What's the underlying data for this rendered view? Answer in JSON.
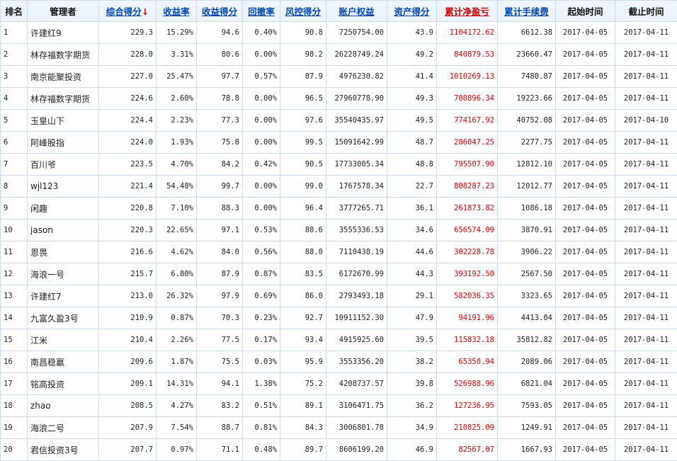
{
  "columns": [
    {
      "label": "排名",
      "style": "plain"
    },
    {
      "label": "管理者",
      "style": "plain"
    },
    {
      "label": "综合得分",
      "style": "link",
      "sort_arrow": "↓"
    },
    {
      "label": "收益率",
      "style": "link"
    },
    {
      "label": "收益得分",
      "style": "link"
    },
    {
      "label": "回撤率",
      "style": "link"
    },
    {
      "label": "风控得分",
      "style": "link"
    },
    {
      "label": "账户权益",
      "style": "link"
    },
    {
      "label": "资产得分",
      "style": "link"
    },
    {
      "label": "累计净盈亏",
      "style": "red-link"
    },
    {
      "label": "累计手续费",
      "style": "link"
    },
    {
      "label": "起始时间",
      "style": "plain"
    },
    {
      "label": "截止时间",
      "style": "plain"
    }
  ],
  "colors": {
    "header_bg": "#eef4fb",
    "border": "#cdddef",
    "link": "#0047b3",
    "profit": "#e00000"
  },
  "rows": [
    [
      "1",
      "许建红9",
      "229.3",
      "15.29%",
      "94.6",
      "0.40%",
      "90.8",
      "7250754.00",
      "43.9",
      "1104172.62",
      "6612.38",
      "2017-04-05",
      "2017-04-11"
    ],
    [
      "2",
      "林存福数字期货",
      "228.0",
      "3.31%",
      "80.6",
      "0.00%",
      "98.2",
      "26228749.24",
      "49.2",
      "840879.53",
      "23660.47",
      "2017-04-05",
      "2017-04-11"
    ],
    [
      "3",
      "南京能聚投资",
      "227.0",
      "25.47%",
      "97.7",
      "0.57%",
      "87.9",
      "4976230.82",
      "41.4",
      "1010269.13",
      "7480.87",
      "2017-04-05",
      "2017-04-11"
    ],
    [
      "4",
      "林存福数字期货",
      "224.6",
      "2.60%",
      "78.8",
      "0.00%",
      "96.5",
      "27960778.90",
      "49.3",
      "708896.34",
      "19223.66",
      "2017-04-05",
      "2017-04-11"
    ],
    [
      "5",
      "玉皇山下",
      "224.4",
      "2.23%",
      "77.3",
      "0.00%",
      "97.6",
      "35540435.97",
      "49.5",
      "774167.92",
      "40752.08",
      "2017-04-05",
      "2017-04-10"
    ],
    [
      "6",
      "阿峰股指",
      "224.0",
      "1.93%",
      "75.8",
      "0.00%",
      "99.5",
      "15091642.99",
      "48.7",
      "286047.25",
      "2277.75",
      "2017-04-05",
      "2017-04-11"
    ],
    [
      "7",
      "百川爷",
      "223.5",
      "4.70%",
      "84.2",
      "0.42%",
      "90.5",
      "17733005.34",
      "48.8",
      "795507.90",
      "12812.10",
      "2017-04-05",
      "2017-04-11"
    ],
    [
      "8",
      "wjl123",
      "221.4",
      "54.48%",
      "99.7",
      "0.00%",
      "99.0",
      "1767578.34",
      "22.7",
      "808287.23",
      "12012.77",
      "2017-04-05",
      "2017-04-11"
    ],
    [
      "9",
      "闲趣",
      "220.8",
      "7.10%",
      "88.3",
      "0.00%",
      "96.4",
      "3777265.71",
      "36.1",
      "261873.82",
      "1086.18",
      "2017-04-05",
      "2017-04-11"
    ],
    [
      "10",
      "jason",
      "220.3",
      "22.65%",
      "97.1",
      "0.53%",
      "88.6",
      "3555336.53",
      "34.6",
      "656574.09",
      "3870.91",
      "2017-04-05",
      "2017-04-11"
    ],
    [
      "11",
      "恩畏",
      "216.6",
      "4.62%",
      "84.0",
      "0.56%",
      "88.0",
      "7110438.19",
      "44.6",
      "302228.78",
      "3906.22",
      "2017-04-05",
      "2017-04-11"
    ],
    [
      "12",
      "海浪一号",
      "215.7",
      "6.80%",
      "87.9",
      "0.87%",
      "83.5",
      "6172670.99",
      "44.3",
      "393192.50",
      "2567.50",
      "2017-04-05",
      "2017-04-11"
    ],
    [
      "13",
      "许建红7",
      "213.0",
      "26.32%",
      "97.9",
      "0.69%",
      "86.0",
      "2793493.18",
      "29.1",
      "582036.35",
      "3323.65",
      "2017-04-05",
      "2017-04-11"
    ],
    [
      "14",
      "九富久盈3号",
      "210.9",
      "0.87%",
      "70.3",
      "0.23%",
      "92.7",
      "10911152.30",
      "47.9",
      "94191.96",
      "4413.04",
      "2017-04-05",
      "2017-04-11"
    ],
    [
      "15",
      "江米",
      "210.4",
      "2.26%",
      "77.5",
      "0.17%",
      "93.4",
      "4915925.60",
      "39.5",
      "115832.18",
      "35812.82",
      "2017-04-05",
      "2017-04-11"
    ],
    [
      "16",
      "南昌稳赢",
      "209.6",
      "1.87%",
      "75.5",
      "0.03%",
      "95.9",
      "3553356.20",
      "38.2",
      "65350.94",
      "2089.06",
      "2017-04-05",
      "2017-04-11"
    ],
    [
      "17",
      "铭高投资",
      "209.1",
      "14.31%",
      "94.1",
      "1.38%",
      "75.2",
      "4208737.57",
      "39.8",
      "526988.96",
      "6821.04",
      "2017-04-05",
      "2017-04-11"
    ],
    [
      "18",
      "zhao",
      "208.5",
      "4.27%",
      "83.2",
      "0.51%",
      "89.1",
      "3106471.75",
      "36.2",
      "127236.95",
      "7593.05",
      "2017-04-05",
      "2017-04-11"
    ],
    [
      "19",
      "海浪二号",
      "207.9",
      "7.54%",
      "88.7",
      "0.81%",
      "84.3",
      "3006801.78",
      "34.9",
      "210825.09",
      "1249.91",
      "2017-04-05",
      "2017-04-11"
    ],
    [
      "20",
      "君信投资3号",
      "207.7",
      "0.97%",
      "71.1",
      "0.48%",
      "89.7",
      "8606199.20",
      "46.9",
      "82567.07",
      "1667.93",
      "2017-04-05",
      "2017-04-11"
    ]
  ]
}
